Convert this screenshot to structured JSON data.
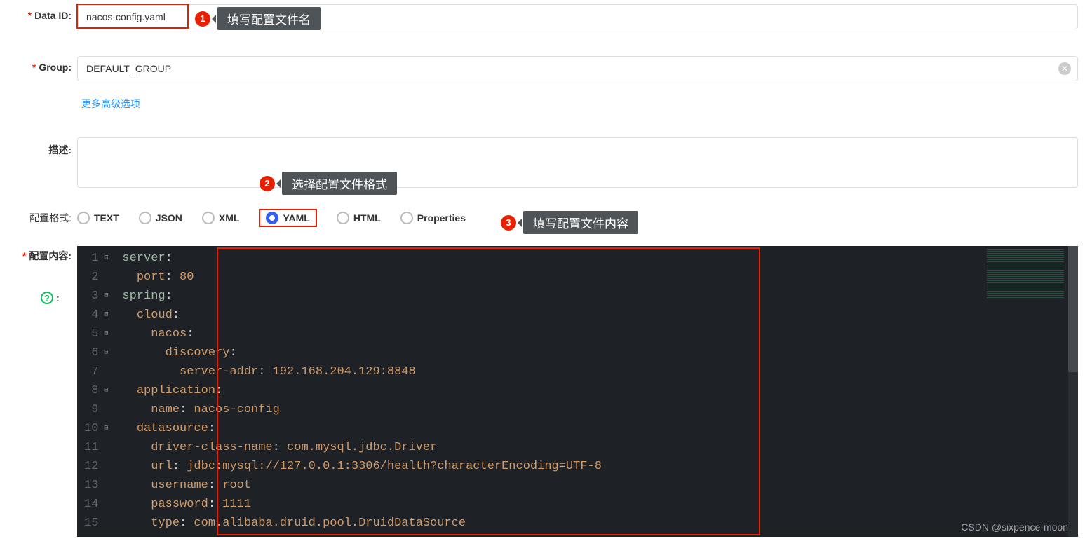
{
  "labels": {
    "dataId": "Data ID:",
    "group": "Group:",
    "more": "更多高级选项",
    "desc": "描述:",
    "format": "配置格式:",
    "content": "配置内容:"
  },
  "form": {
    "dataId": "nacos-config.yaml",
    "group": "DEFAULT_GROUP",
    "desc": ""
  },
  "formats": [
    "TEXT",
    "JSON",
    "XML",
    "YAML",
    "HTML",
    "Properties"
  ],
  "selectedFormat": "YAML",
  "annotations": {
    "a1": "填写配置文件名",
    "a2": "选择配置文件格式",
    "a3": "填写配置文件内容",
    "n1": "1",
    "n2": "2",
    "n3": "3"
  },
  "code": {
    "lines": [
      {
        "n": 1,
        "fold": "⊟",
        "indent": 0,
        "key": "server",
        "val": ""
      },
      {
        "n": 2,
        "fold": "",
        "indent": 1,
        "key": "port",
        "val": " 80"
      },
      {
        "n": 3,
        "fold": "⊟",
        "indent": 0,
        "key": "spring",
        "val": ""
      },
      {
        "n": 4,
        "fold": "⊟",
        "indent": 1,
        "key": "cloud",
        "val": ""
      },
      {
        "n": 5,
        "fold": "⊟",
        "indent": 2,
        "key": "nacos",
        "val": ""
      },
      {
        "n": 6,
        "fold": "⊟",
        "indent": 3,
        "key": "discovery",
        "val": ""
      },
      {
        "n": 7,
        "fold": "",
        "indent": 4,
        "key": "server-addr",
        "val": " 192.168.204.129:8848"
      },
      {
        "n": 8,
        "fold": "⊟",
        "indent": 1,
        "key": "application",
        "val": ""
      },
      {
        "n": 9,
        "fold": "",
        "indent": 2,
        "key": "name",
        "val": " nacos-config"
      },
      {
        "n": 10,
        "fold": "⊟",
        "indent": 1,
        "key": "datasource",
        "val": ""
      },
      {
        "n": 11,
        "fold": "",
        "indent": 2,
        "key": "driver-class-name",
        "val": " com.mysql.jdbc.Driver"
      },
      {
        "n": 12,
        "fold": "",
        "indent": 2,
        "key": "url",
        "val": " jdbc:mysql://127.0.0.1:3306/health?characterEncoding=UTF-8"
      },
      {
        "n": 13,
        "fold": "",
        "indent": 2,
        "key": "username",
        "val": " root"
      },
      {
        "n": 14,
        "fold": "",
        "indent": 2,
        "key": "password",
        "val": " 1111"
      },
      {
        "n": 15,
        "fold": "",
        "indent": 2,
        "key": "type",
        "val": " com.alibaba.druid.pool.DruidDataSource"
      }
    ]
  },
  "watermark": "CSDN @sixpence-moon"
}
